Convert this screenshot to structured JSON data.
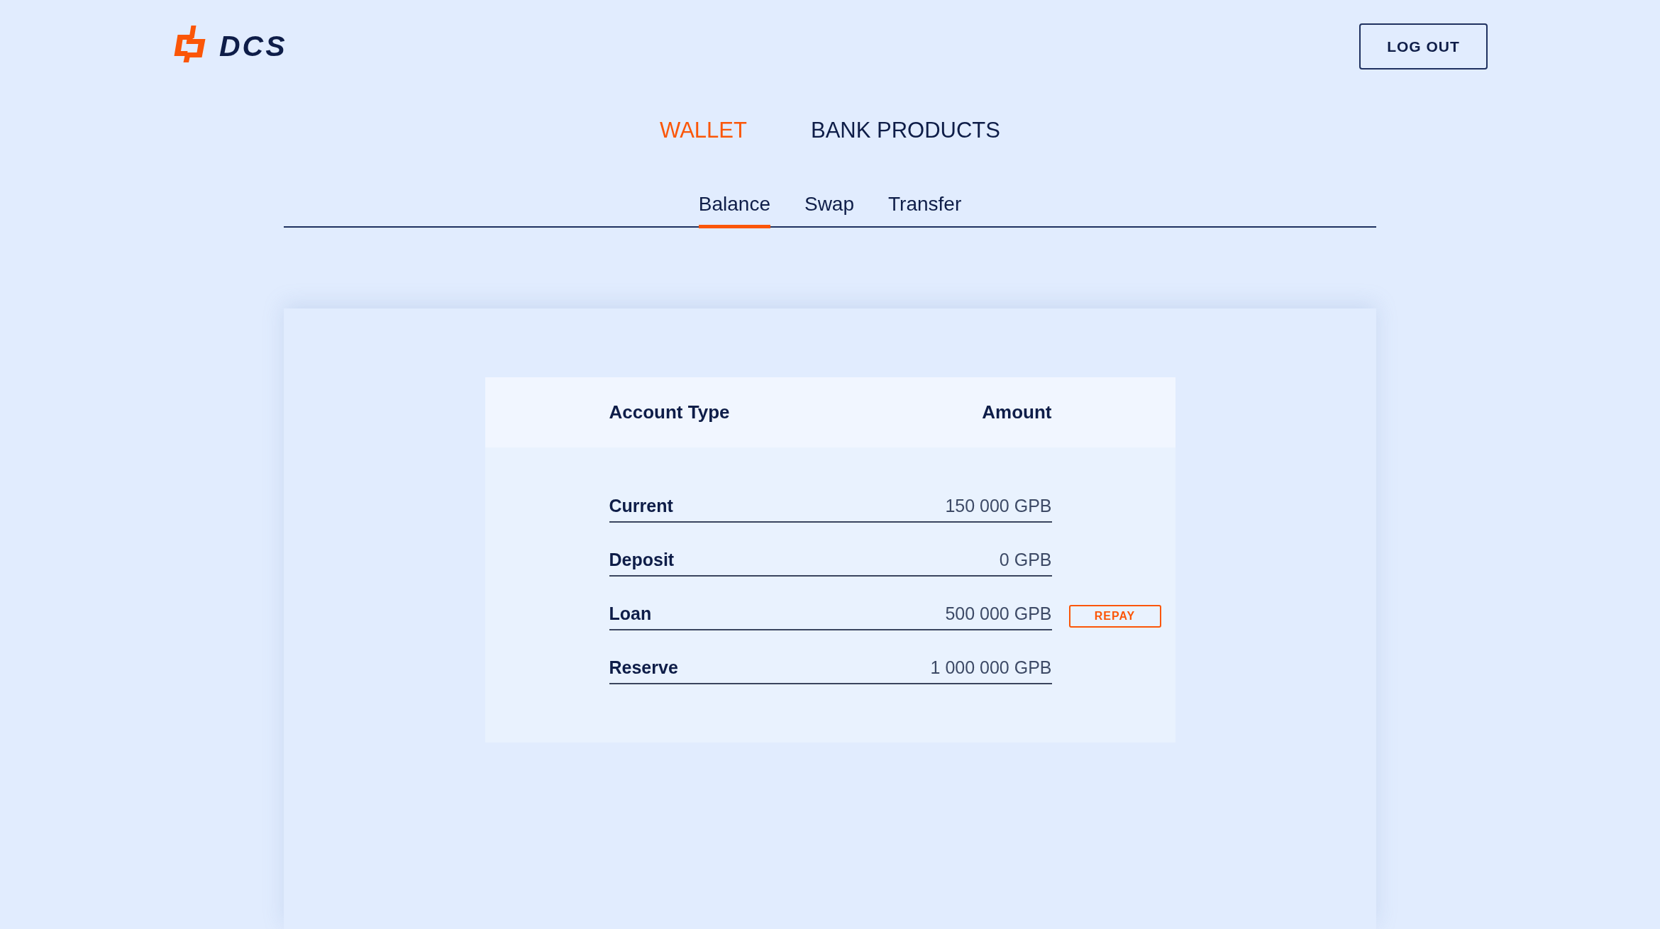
{
  "header": {
    "logo_text": "DCS",
    "logout_button": "LOG OUT"
  },
  "main_nav": [
    {
      "label": "WALLET",
      "selected": true
    },
    {
      "label": "BANK PRODUCTS",
      "selected": false
    }
  ],
  "sub_tabs": [
    {
      "label": "Balance",
      "selected": true
    },
    {
      "label": "Swap",
      "selected": false
    },
    {
      "label": "Transfer",
      "selected": false
    }
  ],
  "balance_table": {
    "columns": [
      "Account Type",
      "Amount"
    ],
    "rows": [
      {
        "account_type": "Current",
        "amount": "150 000 GPB"
      },
      {
        "account_type": "Deposit",
        "amount": "0 GPB"
      },
      {
        "account_type": "Loan",
        "amount": "500 000 GPB",
        "action": "REPAY"
      },
      {
        "account_type": "Reserve",
        "amount": "1 000 000 GPB"
      }
    ]
  }
}
